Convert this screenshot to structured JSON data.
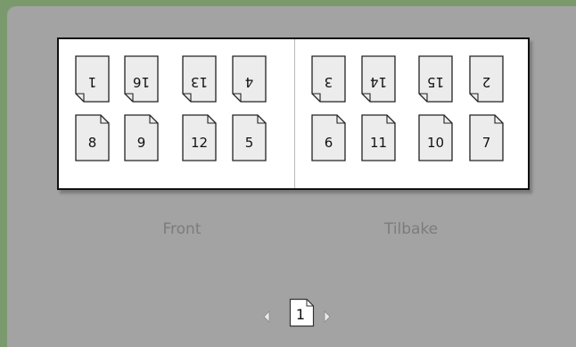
{
  "sides": {
    "front": {
      "label": "Front",
      "top": [
        "1",
        "16",
        "13",
        "4"
      ],
      "bottom": [
        "8",
        "9",
        "12",
        "5"
      ]
    },
    "back": {
      "label": "Tilbake",
      "top": [
        "3",
        "14",
        "15",
        "2"
      ],
      "bottom": [
        "6",
        "11",
        "10",
        "7"
      ]
    }
  },
  "pager": {
    "current": "1",
    "prev_icon": "triangle-left-icon",
    "next_icon": "triangle-right-icon"
  },
  "colors": {
    "window": "#7a9a6e",
    "panel": "#a3a3a3",
    "page_fill": "#ececec",
    "label": "#7c7c7c"
  }
}
